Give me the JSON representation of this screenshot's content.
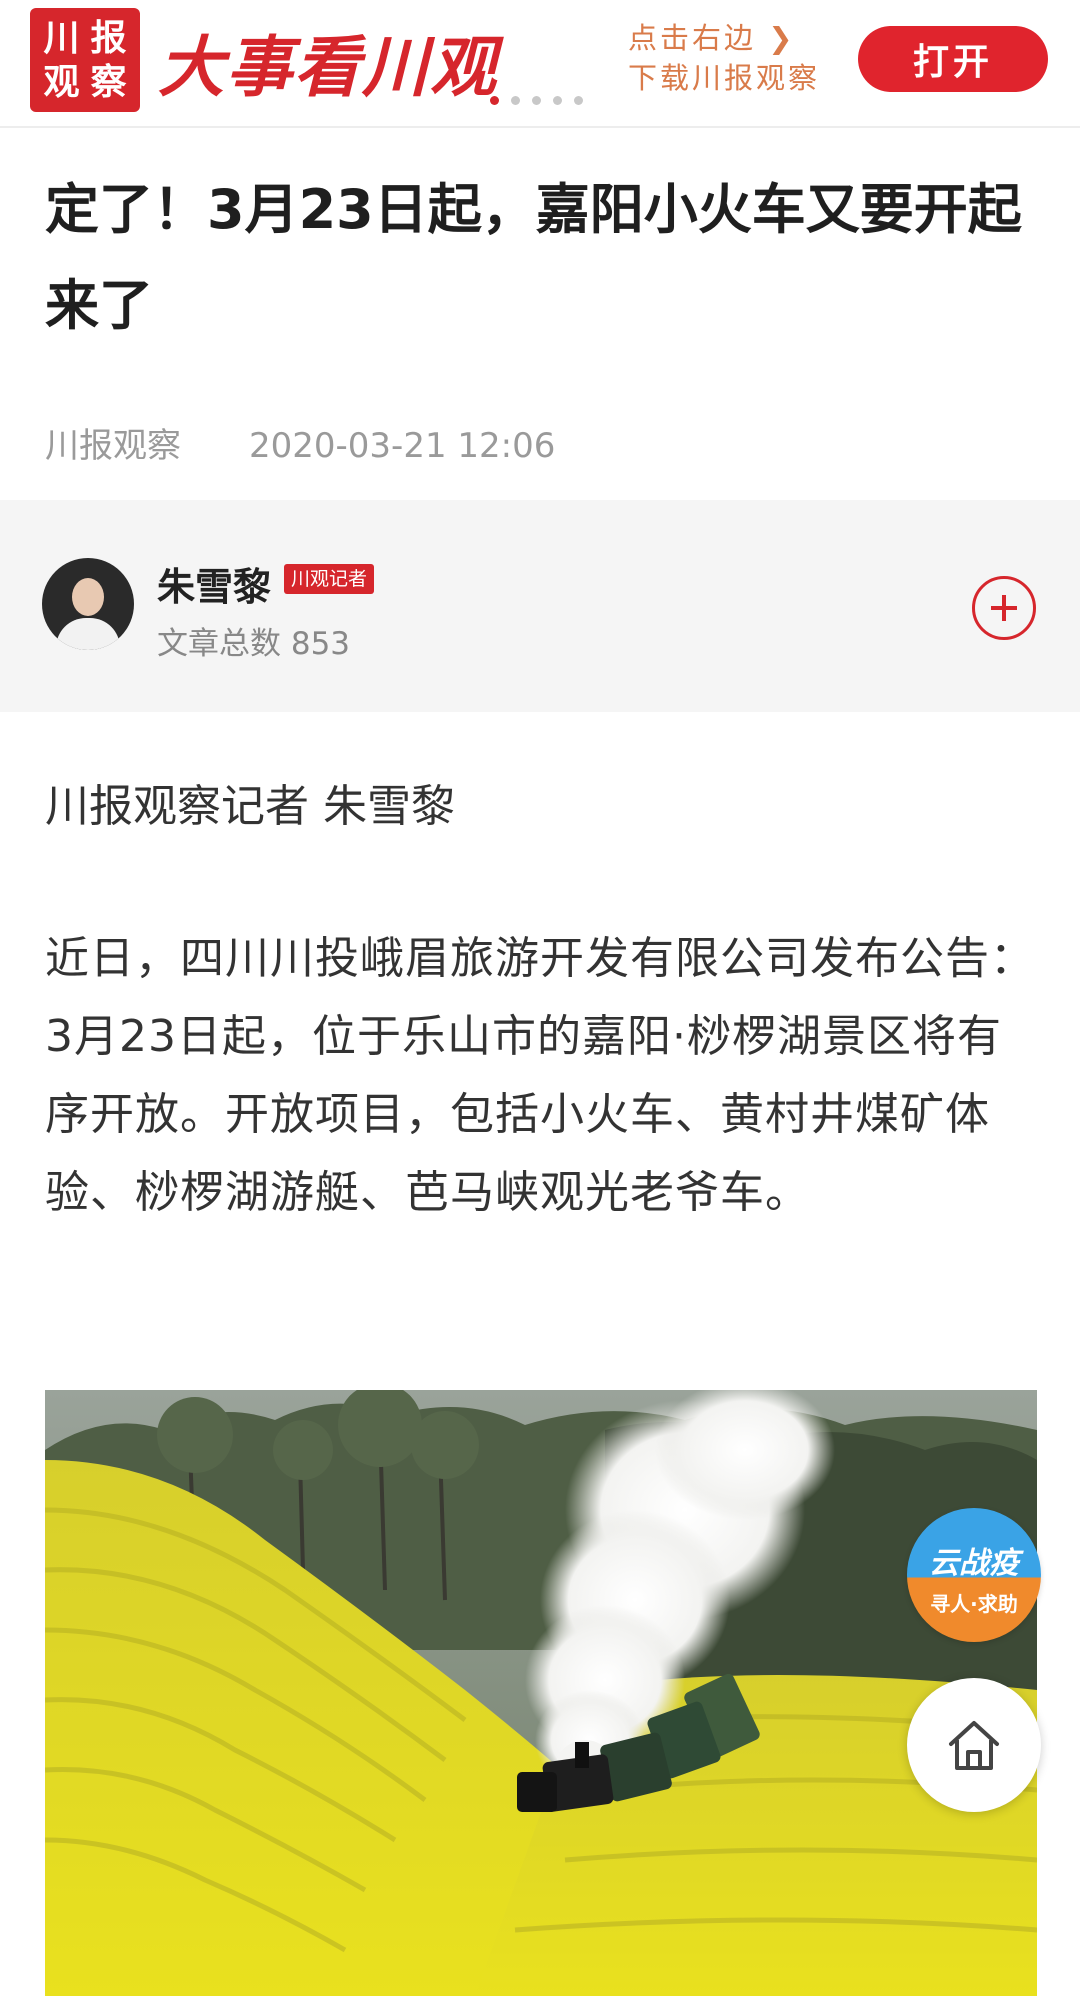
{
  "banner": {
    "logo_chars": [
      "川",
      "报",
      "观",
      "察"
    ],
    "slogan": "大事看川观",
    "promo_line1": "点击右边",
    "promo_arrow": "❯",
    "promo_line2": "下载川报观察",
    "open_button": "打开",
    "carousel_dots": 5,
    "active_dot": 1,
    "brand_color": "#d6262c"
  },
  "article": {
    "title": "定了！3月23日起，嘉阳小火车又要开起来了",
    "source": "川报观察",
    "datetime": "2020-03-21 12:06",
    "byline": "川报观察记者 朱雪黎",
    "paragraph": "近日，四川川投峨眉旅游开发有限公司发布公告：3月23日起，位于乐山市的嘉阳·桫椤湖景区将有序开放。开放项目，包括小火车、黄村井煤矿体验、桫椤湖游艇、芭马峡观光老爷车。"
  },
  "author": {
    "name": "朱雪黎",
    "badge": "川观记者",
    "article_count": "文章总数 853",
    "follow_icon": "plus-circle-icon"
  },
  "floating": {
    "epidemic_title": "云战疫",
    "epidemic_sub": "寻人·求助",
    "home_icon": "home-icon"
  }
}
